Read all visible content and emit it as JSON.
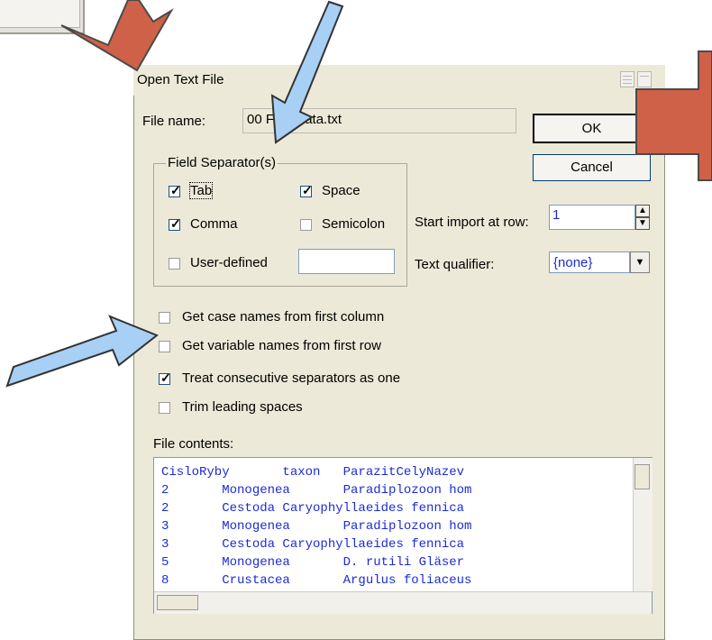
{
  "dialog": {
    "title": "Open Text File",
    "file_name_label": "File name:",
    "file_name_value": "00 Fish Data.txt",
    "ok_label": "OK",
    "cancel_label": "Cancel",
    "separators_label": "Field Separator(s)",
    "separators": [
      {
        "label": "Tab",
        "checked": true
      },
      {
        "label": "Space",
        "checked": true
      },
      {
        "label": "Comma",
        "checked": true
      },
      {
        "label": "Semicolon",
        "checked": false
      },
      {
        "label": "User-defined",
        "checked": false
      }
    ],
    "user_defined_value": "",
    "start_import_label": "Start import at row:",
    "start_import_value": "1",
    "text_qualifier_label": "Text qualifier:",
    "text_qualifier_value": "{none}",
    "options": [
      {
        "label": "Get case names from first column",
        "checked": false
      },
      {
        "label": "Get variable names from first row",
        "checked": false
      },
      {
        "label": "Treat consecutive separators as one",
        "checked": true
      },
      {
        "label": "Trim leading spaces",
        "checked": false
      }
    ],
    "contents_label": "File contents:",
    "contents_rows": [
      "CisloRyby       taxon   ParazitCelyNazev",
      "2       Monogenea       Paradiplozoon hom",
      "2       Cestoda Caryophyllaeides fennica",
      "3       Monogenea       Paradiplozoon hom",
      "3       Cestoda Caryophyllaeides fennica",
      "5       Monogenea       D. rutili Gläser",
      "8       Crustacea       Argulus foliaceus"
    ]
  },
  "annotations": {
    "red_arrow_color": "#cf6148",
    "blue_arrow_color": "#a8d0f5"
  }
}
